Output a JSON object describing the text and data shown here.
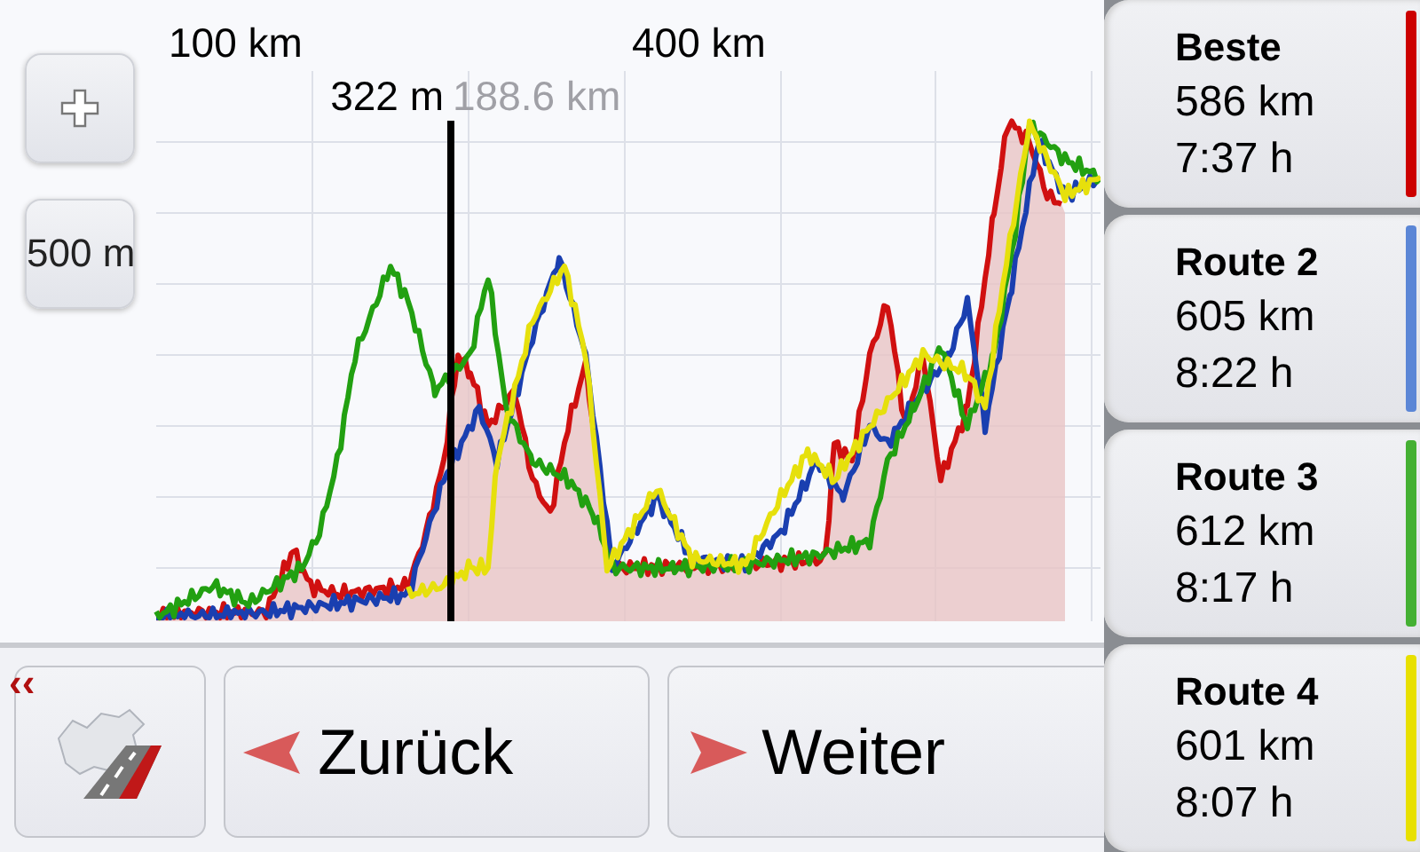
{
  "chart": {
    "scale_labels": [
      "100 km",
      "400 km"
    ],
    "cursor": {
      "elevation": "322 m",
      "distance": "188.6 km"
    }
  },
  "zoom_buttons": [
    {
      "kind": "plus"
    },
    {
      "kind": "scale",
      "label": "500 m"
    }
  ],
  "back_mark": "‹‹",
  "nav_buttons": [
    {
      "kind": "back",
      "label": "Zurück"
    },
    {
      "kind": "next",
      "label": "Weiter"
    }
  ],
  "routes": [
    {
      "name": "Beste",
      "distance": "586 km",
      "time": "7:37 h",
      "color": "#cc0000"
    },
    {
      "name": "Route 2",
      "distance": "605 km",
      "time": "8:22 h",
      "color": "#5b86d6"
    },
    {
      "name": "Route 3",
      "distance": "612 km",
      "time": "8:17 h",
      "color": "#44b033"
    },
    {
      "name": "Route 4",
      "distance": "601 km",
      "time": "8:07 h",
      "color": "#e8e000"
    }
  ]
}
